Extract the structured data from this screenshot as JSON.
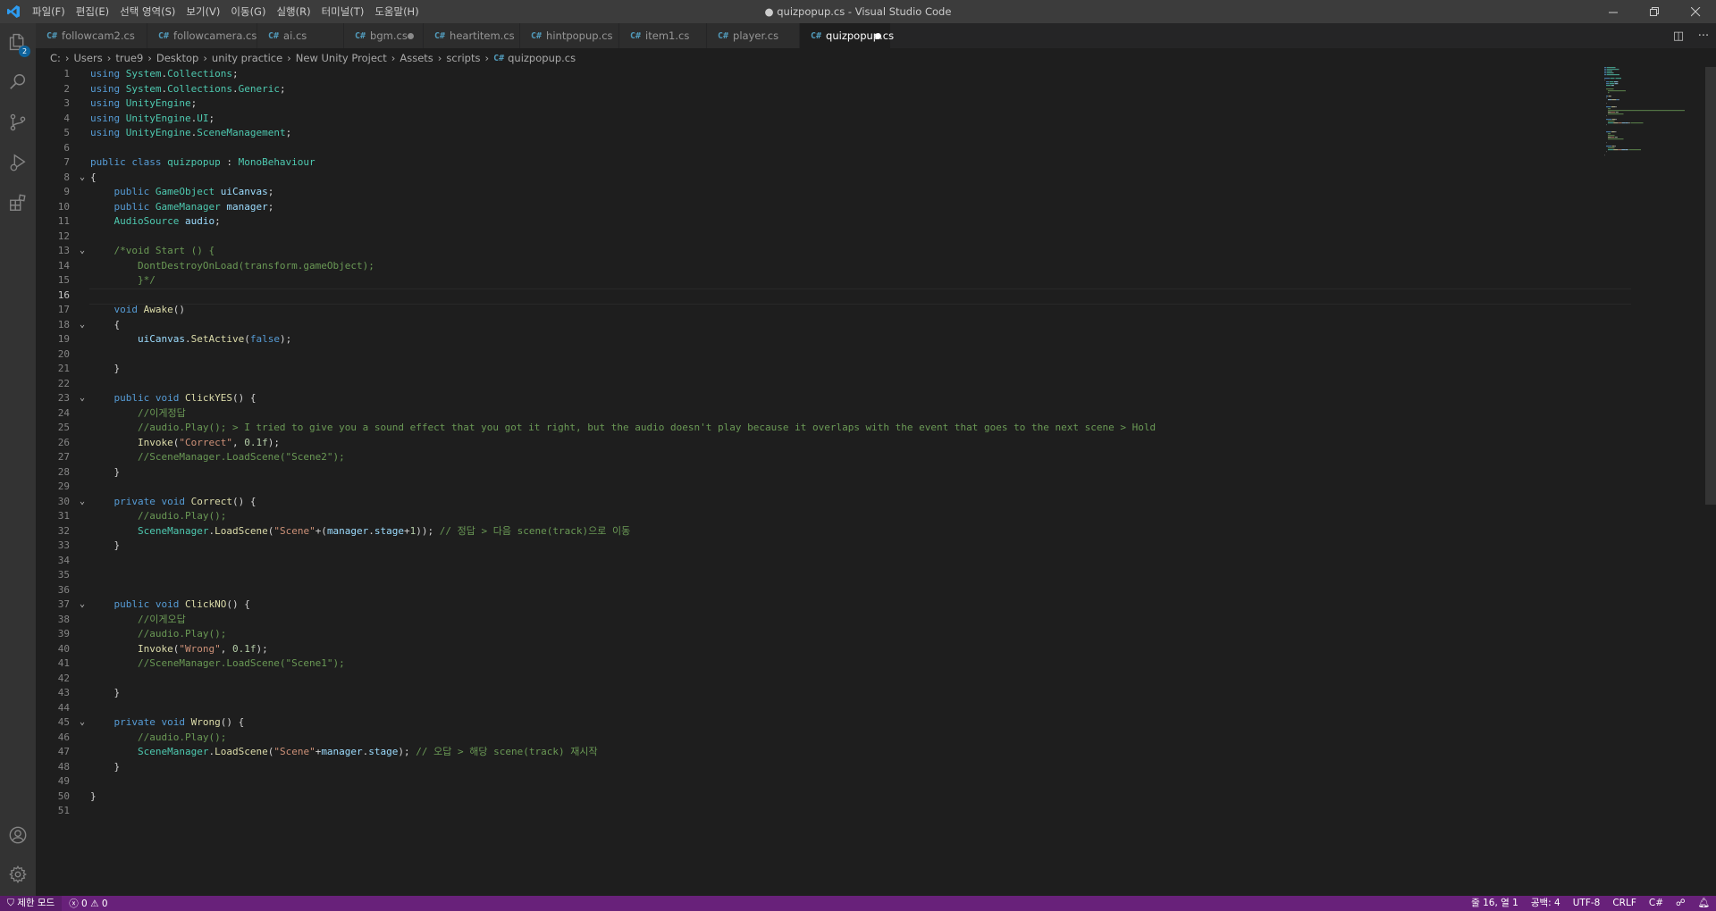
{
  "window": {
    "title": "● quizpopup.cs - Visual Studio Code",
    "menu": [
      "파일(F)",
      "편집(E)",
      "선택 영역(S)",
      "보기(V)",
      "이동(G)",
      "실행(R)",
      "터미널(T)",
      "도움말(H)"
    ]
  },
  "activity": {
    "explorer_badge": "2"
  },
  "tabs": [
    {
      "label": "followcam2.cs",
      "modified": false,
      "active": false
    },
    {
      "label": "followcamera.cs",
      "modified": false,
      "active": false
    },
    {
      "label": "ai.cs",
      "modified": false,
      "active": false
    },
    {
      "label": "bgm.cs",
      "modified": true,
      "active": false
    },
    {
      "label": "heartitem.cs",
      "modified": false,
      "active": false
    },
    {
      "label": "hintpopup.cs",
      "modified": false,
      "active": false
    },
    {
      "label": "item1.cs",
      "modified": false,
      "active": false
    },
    {
      "label": "player.cs",
      "modified": false,
      "active": false
    },
    {
      "label": "quizpopup.cs",
      "modified": true,
      "active": true
    }
  ],
  "breadcrumb": [
    "C:",
    "Users",
    "true9",
    "Desktop",
    "unity practice",
    "New Unity Project",
    "Assets",
    "scripts",
    "quizpopup.cs"
  ],
  "editor": {
    "current_line": 16,
    "fold_lines": [
      8,
      13,
      18,
      23,
      30,
      37,
      45
    ],
    "lines": [
      [
        [
          "k",
          "using "
        ],
        [
          "t",
          "System"
        ],
        [
          "",
          "."
        ],
        [
          "t",
          "Collections"
        ],
        [
          "",
          ";"
        ]
      ],
      [
        [
          "k",
          "using "
        ],
        [
          "t",
          "System"
        ],
        [
          "",
          "."
        ],
        [
          "t",
          "Collections"
        ],
        [
          "",
          "."
        ],
        [
          "t",
          "Generic"
        ],
        [
          "",
          ";"
        ]
      ],
      [
        [
          "k",
          "using "
        ],
        [
          "t",
          "UnityEngine"
        ],
        [
          "",
          ";"
        ]
      ],
      [
        [
          "k",
          "using "
        ],
        [
          "t",
          "UnityEngine"
        ],
        [
          "",
          "."
        ],
        [
          "t",
          "UI"
        ],
        [
          "",
          ";"
        ]
      ],
      [
        [
          "k",
          "using "
        ],
        [
          "t",
          "UnityEngine"
        ],
        [
          "",
          "."
        ],
        [
          "t",
          "SceneManagement"
        ],
        [
          "",
          ";"
        ]
      ],
      [],
      [
        [
          "k",
          "public class "
        ],
        [
          "t",
          "quizpopup"
        ],
        [
          "",
          " : "
        ],
        [
          "t",
          "MonoBehaviour"
        ]
      ],
      [
        [
          "",
          "{"
        ]
      ],
      [
        [
          "",
          "    "
        ],
        [
          "k",
          "public "
        ],
        [
          "t",
          "GameObject "
        ],
        [
          "v",
          "uiCanvas"
        ],
        [
          "",
          ";"
        ]
      ],
      [
        [
          "",
          "    "
        ],
        [
          "k",
          "public "
        ],
        [
          "t",
          "GameManager "
        ],
        [
          "v",
          "manager"
        ],
        [
          "",
          ";"
        ]
      ],
      [
        [
          "",
          "    "
        ],
        [
          "t",
          "AudioSource "
        ],
        [
          "v",
          "audio"
        ],
        [
          "",
          ";"
        ]
      ],
      [],
      [
        [
          "",
          "    "
        ],
        [
          "c",
          "/*void Start () {"
        ]
      ],
      [
        [
          "c",
          "        DontDestroyOnLoad(transform.gameObject);"
        ]
      ],
      [
        [
          "c",
          "        }*/"
        ]
      ],
      [],
      [
        [
          "",
          "    "
        ],
        [
          "k",
          "void "
        ],
        [
          "f",
          "Awake"
        ],
        [
          "",
          "()"
        ]
      ],
      [
        [
          "",
          "    {"
        ]
      ],
      [
        [
          "",
          "        "
        ],
        [
          "v",
          "uiCanvas"
        ],
        [
          "",
          "."
        ],
        [
          "f",
          "SetActive"
        ],
        [
          "",
          "("
        ],
        [
          "k",
          "false"
        ],
        [
          "",
          ");"
        ]
      ],
      [],
      [
        [
          "",
          "    }"
        ]
      ],
      [],
      [
        [
          "",
          "    "
        ],
        [
          "k",
          "public void "
        ],
        [
          "f",
          "ClickYES"
        ],
        [
          "",
          "() {"
        ]
      ],
      [
        [
          "",
          "        "
        ],
        [
          "c",
          "//이게정답"
        ]
      ],
      [
        [
          "",
          "        "
        ],
        [
          "c",
          "//audio.Play(); > I tried to give you a sound effect that you got it right, but the audio doesn't play because it overlaps with the event that goes to the next scene > Hold"
        ]
      ],
      [
        [
          "",
          "        "
        ],
        [
          "f",
          "Invoke"
        ],
        [
          "",
          "("
        ],
        [
          "s",
          "\"Correct\""
        ],
        [
          "",
          ", "
        ],
        [
          "n",
          "0.1f"
        ],
        [
          "",
          ");"
        ]
      ],
      [
        [
          "",
          "        "
        ],
        [
          "c",
          "//SceneManager.LoadScene(\"Scene2\");"
        ]
      ],
      [
        [
          "",
          "    }"
        ]
      ],
      [],
      [
        [
          "",
          "    "
        ],
        [
          "k",
          "private void "
        ],
        [
          "f",
          "Correct"
        ],
        [
          "",
          "() {"
        ]
      ],
      [
        [
          "",
          "        "
        ],
        [
          "c",
          "//audio.Play();"
        ]
      ],
      [
        [
          "",
          "        "
        ],
        [
          "t",
          "SceneManager"
        ],
        [
          "",
          "."
        ],
        [
          "f",
          "LoadScene"
        ],
        [
          "",
          "("
        ],
        [
          "s",
          "\"Scene\""
        ],
        [
          "",
          "+("
        ],
        [
          "v",
          "manager"
        ],
        [
          "",
          "."
        ],
        [
          "v",
          "stage"
        ],
        [
          "",
          "+"
        ],
        [
          "n",
          "1"
        ],
        [
          "",
          "));"
        ],
        [
          "",
          " "
        ],
        [
          "c",
          "// 정답 > 다음 scene(track)으로 이동"
        ]
      ],
      [
        [
          "",
          "    }"
        ]
      ],
      [],
      [],
      [],
      [
        [
          "",
          "    "
        ],
        [
          "k",
          "public void "
        ],
        [
          "f",
          "ClickNO"
        ],
        [
          "",
          "() {"
        ]
      ],
      [
        [
          "",
          "        "
        ],
        [
          "c",
          "//이게오답"
        ]
      ],
      [
        [
          "",
          "        "
        ],
        [
          "c",
          "//audio.Play();"
        ]
      ],
      [
        [
          "",
          "        "
        ],
        [
          "f",
          "Invoke"
        ],
        [
          "",
          "("
        ],
        [
          "s",
          "\"Wrong\""
        ],
        [
          "",
          ", "
        ],
        [
          "n",
          "0.1f"
        ],
        [
          "",
          ");"
        ]
      ],
      [
        [
          "",
          "        "
        ],
        [
          "c",
          "//SceneManager.LoadScene(\"Scene1\");"
        ]
      ],
      [],
      [
        [
          "",
          "    }"
        ]
      ],
      [],
      [
        [
          "",
          "    "
        ],
        [
          "k",
          "private void "
        ],
        [
          "f",
          "Wrong"
        ],
        [
          "",
          "() {"
        ]
      ],
      [
        [
          "",
          "        "
        ],
        [
          "c",
          "//audio.Play();"
        ]
      ],
      [
        [
          "",
          "        "
        ],
        [
          "t",
          "SceneManager"
        ],
        [
          "",
          "."
        ],
        [
          "f",
          "LoadScene"
        ],
        [
          "",
          "("
        ],
        [
          "s",
          "\"Scene\""
        ],
        [
          "",
          "+"
        ],
        [
          "v",
          "manager"
        ],
        [
          "",
          "."
        ],
        [
          "v",
          "stage"
        ],
        [
          "",
          ");"
        ],
        [
          "",
          " "
        ],
        [
          "c",
          "// 오답 > 해당 scene(track) 재시작"
        ]
      ],
      [
        [
          "",
          "    }"
        ]
      ],
      [],
      [
        [
          "",
          "}"
        ]
      ],
      []
    ]
  },
  "statusbar": {
    "restricted": "제한 모드",
    "errors": "0",
    "warnings": "0",
    "position": "줄 16, 열 1",
    "spaces": "공백: 4",
    "encoding": "UTF-8",
    "eol": "CRLF",
    "language": "C#"
  }
}
